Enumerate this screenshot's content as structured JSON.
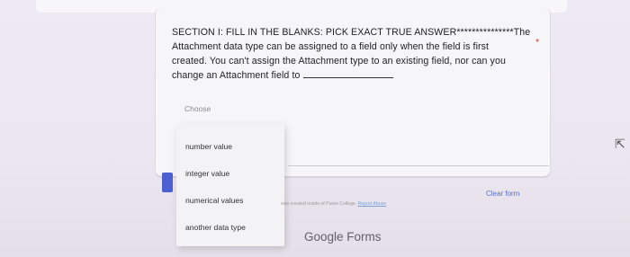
{
  "question": {
    "text_line1": "SECTION I:   FILL IN THE BLANKS:  PICK EXACT TRUE ANSWER***************The",
    "text_line2": "Attachment data type can be assigned to a field only when the field is first",
    "text_line3": "created. You can't assign the Attachment type to an existing field, nor can you",
    "text_line4": "change an Attachment field to",
    "required_marker": "*"
  },
  "select": {
    "placeholder": "Choose"
  },
  "dropdown": {
    "options": [
      "number value",
      "integer value",
      "numerical values",
      "another data type"
    ]
  },
  "footer": {
    "clear_form": "Clear form",
    "created_note": "was created inside of Pures College.",
    "report_abuse": "Report Abuse",
    "brand": "Google Forms"
  }
}
